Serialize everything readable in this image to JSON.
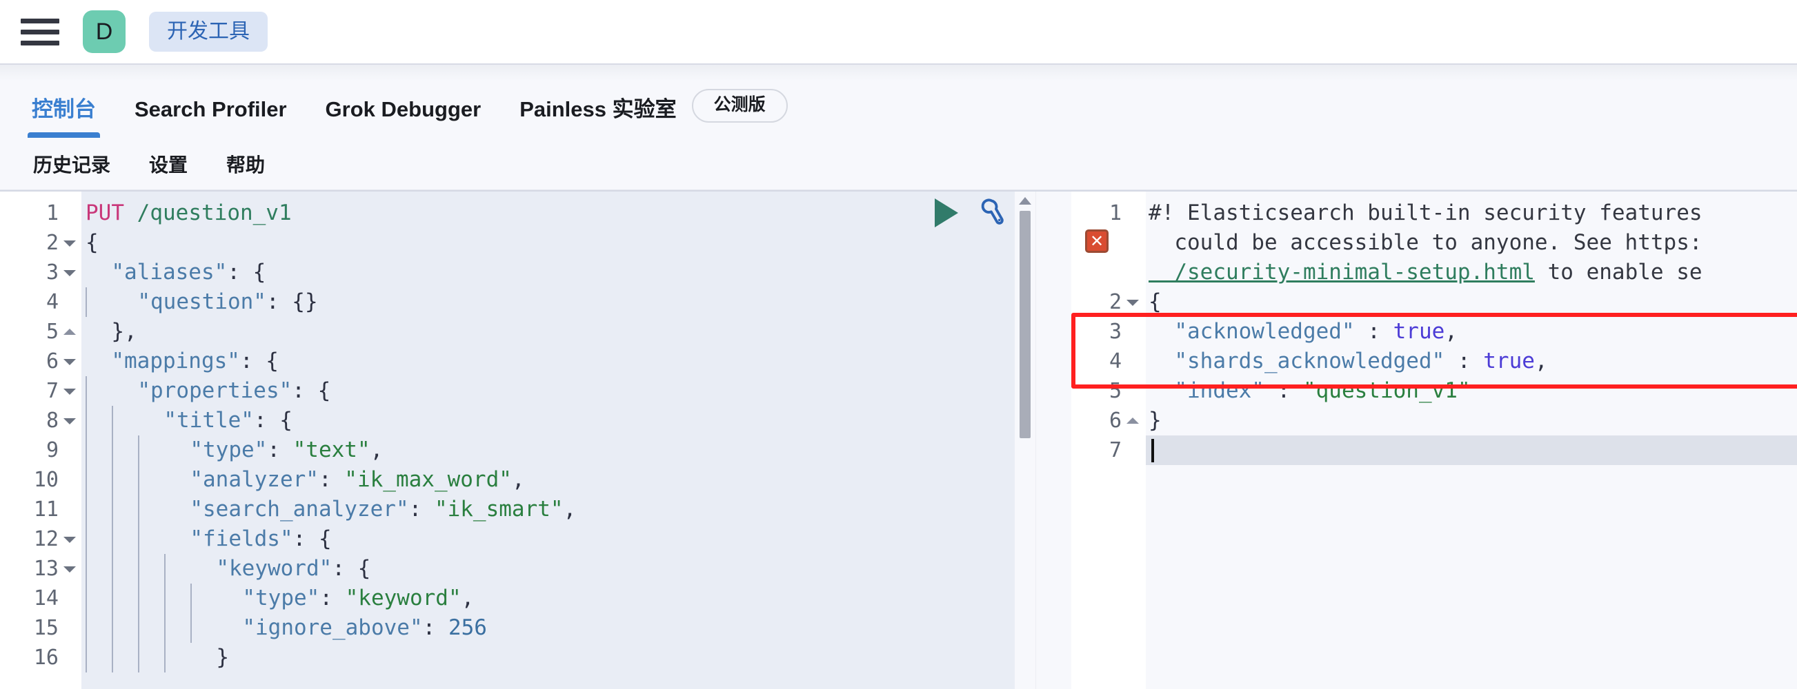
{
  "topbar": {
    "menu_icon": "hamburger-icon",
    "avatar_letter": "D",
    "avatar_color": "#6dccb1",
    "app_pill_label": "开发工具",
    "app_pill_bg": "#dce5f5",
    "app_pill_color": "#2c64b4"
  },
  "primary_tabs": [
    {
      "label": "控制台",
      "active": true
    },
    {
      "label": "Search Profiler",
      "active": false
    },
    {
      "label": "Grok Debugger",
      "active": false
    },
    {
      "label": "Painless 实验室",
      "active": false
    }
  ],
  "beta_badge": "公测版",
  "subnav": [
    {
      "label": "历史记录"
    },
    {
      "label": "设置"
    },
    {
      "label": "帮助"
    }
  ],
  "accent_color": "#3a7fd0",
  "editor": {
    "run_button": "play-icon",
    "wrench_button": "wrench-icon",
    "lines": [
      {
        "n": "1",
        "fold": "none",
        "indent": 0,
        "tokens": [
          {
            "t": "PUT",
            "c": "k-method"
          },
          {
            "t": " ",
            "c": "k-plain"
          },
          {
            "t": "/question_v1",
            "c": "k-path"
          }
        ]
      },
      {
        "n": "2",
        "fold": "down",
        "indent": 0,
        "tokens": [
          {
            "t": "{",
            "c": "k-punc"
          }
        ]
      },
      {
        "n": "3",
        "fold": "down",
        "indent": 0,
        "tokens": [
          {
            "t": "  ",
            "c": "k-plain"
          },
          {
            "t": "\"aliases\"",
            "c": "k-key"
          },
          {
            "t": ": {",
            "c": "k-punc"
          }
        ]
      },
      {
        "n": "4",
        "fold": "none",
        "indent": 1,
        "tokens": [
          {
            "t": "  ",
            "c": "k-plain"
          },
          {
            "t": "\"question\"",
            "c": "k-key"
          },
          {
            "t": ": {}",
            "c": "k-punc"
          }
        ]
      },
      {
        "n": "5",
        "fold": "up",
        "indent": 0,
        "tokens": [
          {
            "t": "  },",
            "c": "k-punc"
          }
        ]
      },
      {
        "n": "6",
        "fold": "down",
        "indent": 0,
        "tokens": [
          {
            "t": "  ",
            "c": "k-plain"
          },
          {
            "t": "\"mappings\"",
            "c": "k-key"
          },
          {
            "t": ": {",
            "c": "k-punc"
          }
        ]
      },
      {
        "n": "7",
        "fold": "down",
        "indent": 1,
        "tokens": [
          {
            "t": "  ",
            "c": "k-plain"
          },
          {
            "t": "\"properties\"",
            "c": "k-key"
          },
          {
            "t": ": {",
            "c": "k-punc"
          }
        ]
      },
      {
        "n": "8",
        "fold": "down",
        "indent": 2,
        "tokens": [
          {
            "t": "  ",
            "c": "k-plain"
          },
          {
            "t": "\"title\"",
            "c": "k-key"
          },
          {
            "t": ": {",
            "c": "k-punc"
          }
        ]
      },
      {
        "n": "9",
        "fold": "none",
        "indent": 3,
        "tokens": [
          {
            "t": "  ",
            "c": "k-plain"
          },
          {
            "t": "\"type\"",
            "c": "k-key"
          },
          {
            "t": ": ",
            "c": "k-punc"
          },
          {
            "t": "\"text\"",
            "c": "k-str"
          },
          {
            "t": ",",
            "c": "k-punc"
          }
        ]
      },
      {
        "n": "10",
        "fold": "none",
        "indent": 3,
        "tokens": [
          {
            "t": "  ",
            "c": "k-plain"
          },
          {
            "t": "\"analyzer\"",
            "c": "k-key"
          },
          {
            "t": ": ",
            "c": "k-punc"
          },
          {
            "t": "\"ik_max_word\"",
            "c": "k-str"
          },
          {
            "t": ",",
            "c": "k-punc"
          }
        ]
      },
      {
        "n": "11",
        "fold": "none",
        "indent": 3,
        "tokens": [
          {
            "t": "  ",
            "c": "k-plain"
          },
          {
            "t": "\"search_analyzer\"",
            "c": "k-key"
          },
          {
            "t": ": ",
            "c": "k-punc"
          },
          {
            "t": "\"ik_smart\"",
            "c": "k-str"
          },
          {
            "t": ",",
            "c": "k-punc"
          }
        ]
      },
      {
        "n": "12",
        "fold": "down",
        "indent": 3,
        "tokens": [
          {
            "t": "  ",
            "c": "k-plain"
          },
          {
            "t": "\"fields\"",
            "c": "k-key"
          },
          {
            "t": ": {",
            "c": "k-punc"
          }
        ]
      },
      {
        "n": "13",
        "fold": "down",
        "indent": 4,
        "tokens": [
          {
            "t": "  ",
            "c": "k-plain"
          },
          {
            "t": "\"keyword\"",
            "c": "k-key"
          },
          {
            "t": ": {",
            "c": "k-punc"
          }
        ]
      },
      {
        "n": "14",
        "fold": "none",
        "indent": 5,
        "tokens": [
          {
            "t": "  ",
            "c": "k-plain"
          },
          {
            "t": "\"type\"",
            "c": "k-key"
          },
          {
            "t": ": ",
            "c": "k-punc"
          },
          {
            "t": "\"keyword\"",
            "c": "k-str"
          },
          {
            "t": ",",
            "c": "k-punc"
          }
        ]
      },
      {
        "n": "15",
        "fold": "none",
        "indent": 5,
        "tokens": [
          {
            "t": "  ",
            "c": "k-plain"
          },
          {
            "t": "\"ignore_above\"",
            "c": "k-key"
          },
          {
            "t": ": ",
            "c": "k-punc"
          },
          {
            "t": "256",
            "c": "k-num"
          }
        ]
      },
      {
        "n": "16",
        "fold": "none",
        "indent": 4,
        "tokens": [
          {
            "t": "  }",
            "c": "k-punc"
          }
        ]
      }
    ]
  },
  "response": {
    "error_marker": "error-icon",
    "lines": [
      {
        "n": "1",
        "fold": "none",
        "highlight": false,
        "tokens": [
          {
            "t": "#! Elasticsearch built-in security features",
            "c": "k-comment"
          }
        ]
      },
      {
        "n": "",
        "fold": "none",
        "highlight": false,
        "tokens": [
          {
            "t": "  could be accessible to anyone. See https:",
            "c": "k-comment"
          }
        ]
      },
      {
        "n": "",
        "fold": "none",
        "highlight": false,
        "tokens": [
          {
            "t": "  /security-minimal-setup.html",
            "c": "k-link"
          },
          {
            "t": " to enable se",
            "c": "k-comment"
          }
        ]
      },
      {
        "n": "2",
        "fold": "down",
        "highlight": false,
        "tokens": [
          {
            "t": "{",
            "c": "k-punc"
          }
        ]
      },
      {
        "n": "3",
        "fold": "none",
        "highlight": false,
        "tokens": [
          {
            "t": "  ",
            "c": "k-plain"
          },
          {
            "t": "\"acknowledged\"",
            "c": "k-key"
          },
          {
            "t": " : ",
            "c": "k-punc"
          },
          {
            "t": "true",
            "c": "k-bool"
          },
          {
            "t": ",",
            "c": "k-punc"
          }
        ]
      },
      {
        "n": "4",
        "fold": "none",
        "highlight": false,
        "tokens": [
          {
            "t": "  ",
            "c": "k-plain"
          },
          {
            "t": "\"shards_acknowledged\"",
            "c": "k-key"
          },
          {
            "t": " : ",
            "c": "k-punc"
          },
          {
            "t": "true",
            "c": "k-bool"
          },
          {
            "t": ",",
            "c": "k-punc"
          }
        ]
      },
      {
        "n": "5",
        "fold": "none",
        "highlight": false,
        "tokens": [
          {
            "t": "  ",
            "c": "k-plain"
          },
          {
            "t": "\"index\"",
            "c": "k-key"
          },
          {
            "t": " : ",
            "c": "k-punc"
          },
          {
            "t": "\"question_v1\"",
            "c": "k-str"
          }
        ]
      },
      {
        "n": "6",
        "fold": "up",
        "highlight": false,
        "tokens": [
          {
            "t": "}",
            "c": "k-punc"
          }
        ]
      },
      {
        "n": "7",
        "fold": "none",
        "highlight": true,
        "caret": true,
        "tokens": []
      }
    ],
    "highlight_box_color": "#ff2020"
  }
}
